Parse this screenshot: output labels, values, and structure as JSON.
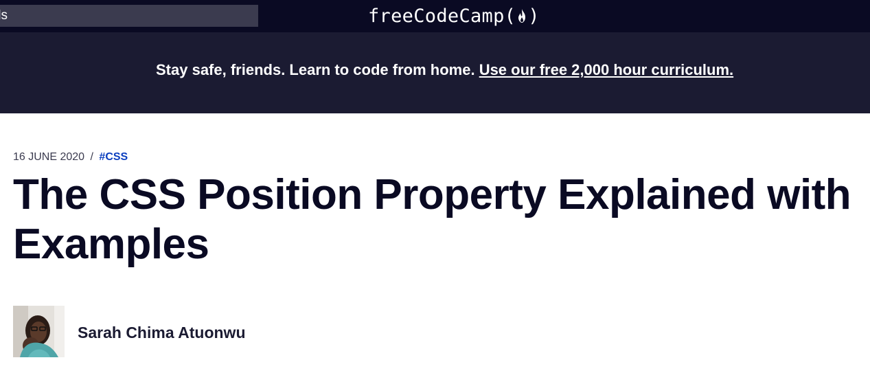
{
  "nav": {
    "search_text": "ıls",
    "logo_text_left": "freeCodeCamp(",
    "logo_text_right": ")",
    "logo_icon": "fire-icon"
  },
  "banner": {
    "text": "Stay safe, friends. Learn to code from home.",
    "link_text": "Use our free 2,000 hour curriculum."
  },
  "article": {
    "date": "16 JUNE 2020",
    "separator": "/",
    "tag": "#CSS",
    "title": "The CSS Position Property Explained with Examples",
    "author": "Sarah Chima Atuonwu"
  },
  "colors": {
    "nav_bg": "#0a0a23",
    "banner_bg": "#1b1b32",
    "search_bg": "#3b3b4f",
    "tag_color": "#0a3ebf",
    "title_color": "#0a0a23"
  }
}
